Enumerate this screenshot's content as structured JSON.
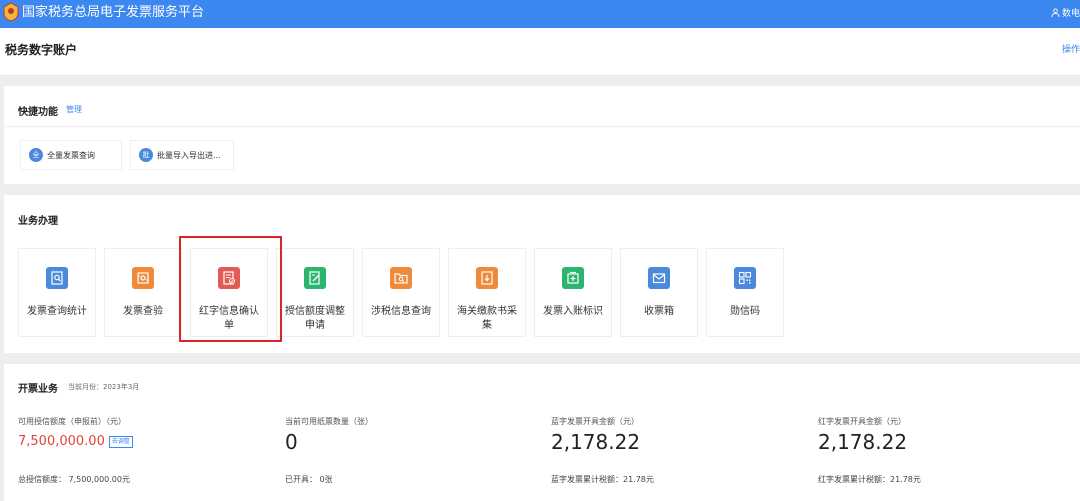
{
  "topbar": {
    "title": "国家税务总局电子发票服务平台",
    "user": "数电",
    "bg_color": "#3c87f0"
  },
  "header": {
    "title": "税务数字账户",
    "action": "操作"
  },
  "quick": {
    "title": "快捷功能",
    "manage": "管理",
    "buttons": [
      {
        "icon": "全",
        "label": "全量发票查询"
      },
      {
        "icon": "批",
        "label": "批量导入导出进..."
      }
    ]
  },
  "business": {
    "title": "业务办理",
    "tiles": [
      {
        "label": "发票查询统计",
        "icon": "search-doc-icon",
        "color": "#4a89dc"
      },
      {
        "label": "发票查验",
        "icon": "scan-icon",
        "color": "#ef8a3b"
      },
      {
        "label": "红字信息确认单",
        "icon": "red-confirm-icon",
        "color": "#e25c55"
      },
      {
        "label": "授信额度调整申请",
        "icon": "edit-doc-icon",
        "color": "#2cb56f"
      },
      {
        "label": "涉税信息查询",
        "icon": "folder-search-icon",
        "color": "#ef8a3b"
      },
      {
        "label": "海关缴款书采集",
        "icon": "download-doc-icon",
        "color": "#ef8a3b"
      },
      {
        "label": "发票入账标识",
        "icon": "mark-icon",
        "color": "#2cb56f"
      },
      {
        "label": "收票箱",
        "icon": "mail-icon",
        "color": "#4a89dc"
      },
      {
        "label": "勋信码",
        "icon": "qr-icon",
        "color": "#4a89dc"
      }
    ],
    "highlight_color": "#d9262b"
  },
  "invoice": {
    "title": "开票业务",
    "month": "当前月份：2023年3月",
    "stats": [
      {
        "label": "可用授信额度（申报前）（元）",
        "value": "7,500,000.00",
        "badge": "去调整",
        "sub": "总授信额度：  7,500,000.00元"
      },
      {
        "label": "当前可用纸票数量（张）",
        "value": "0",
        "sub": "已开具：  0张"
      },
      {
        "label": "蓝字发票开具金额（元）",
        "value": "2,178.22",
        "sub": "蓝字发票累计税额：21.78元"
      },
      {
        "label": "红字发票开具金额（元）",
        "value": "2,178.22",
        "sub": "红字发票累计税额：21.78元"
      }
    ]
  }
}
